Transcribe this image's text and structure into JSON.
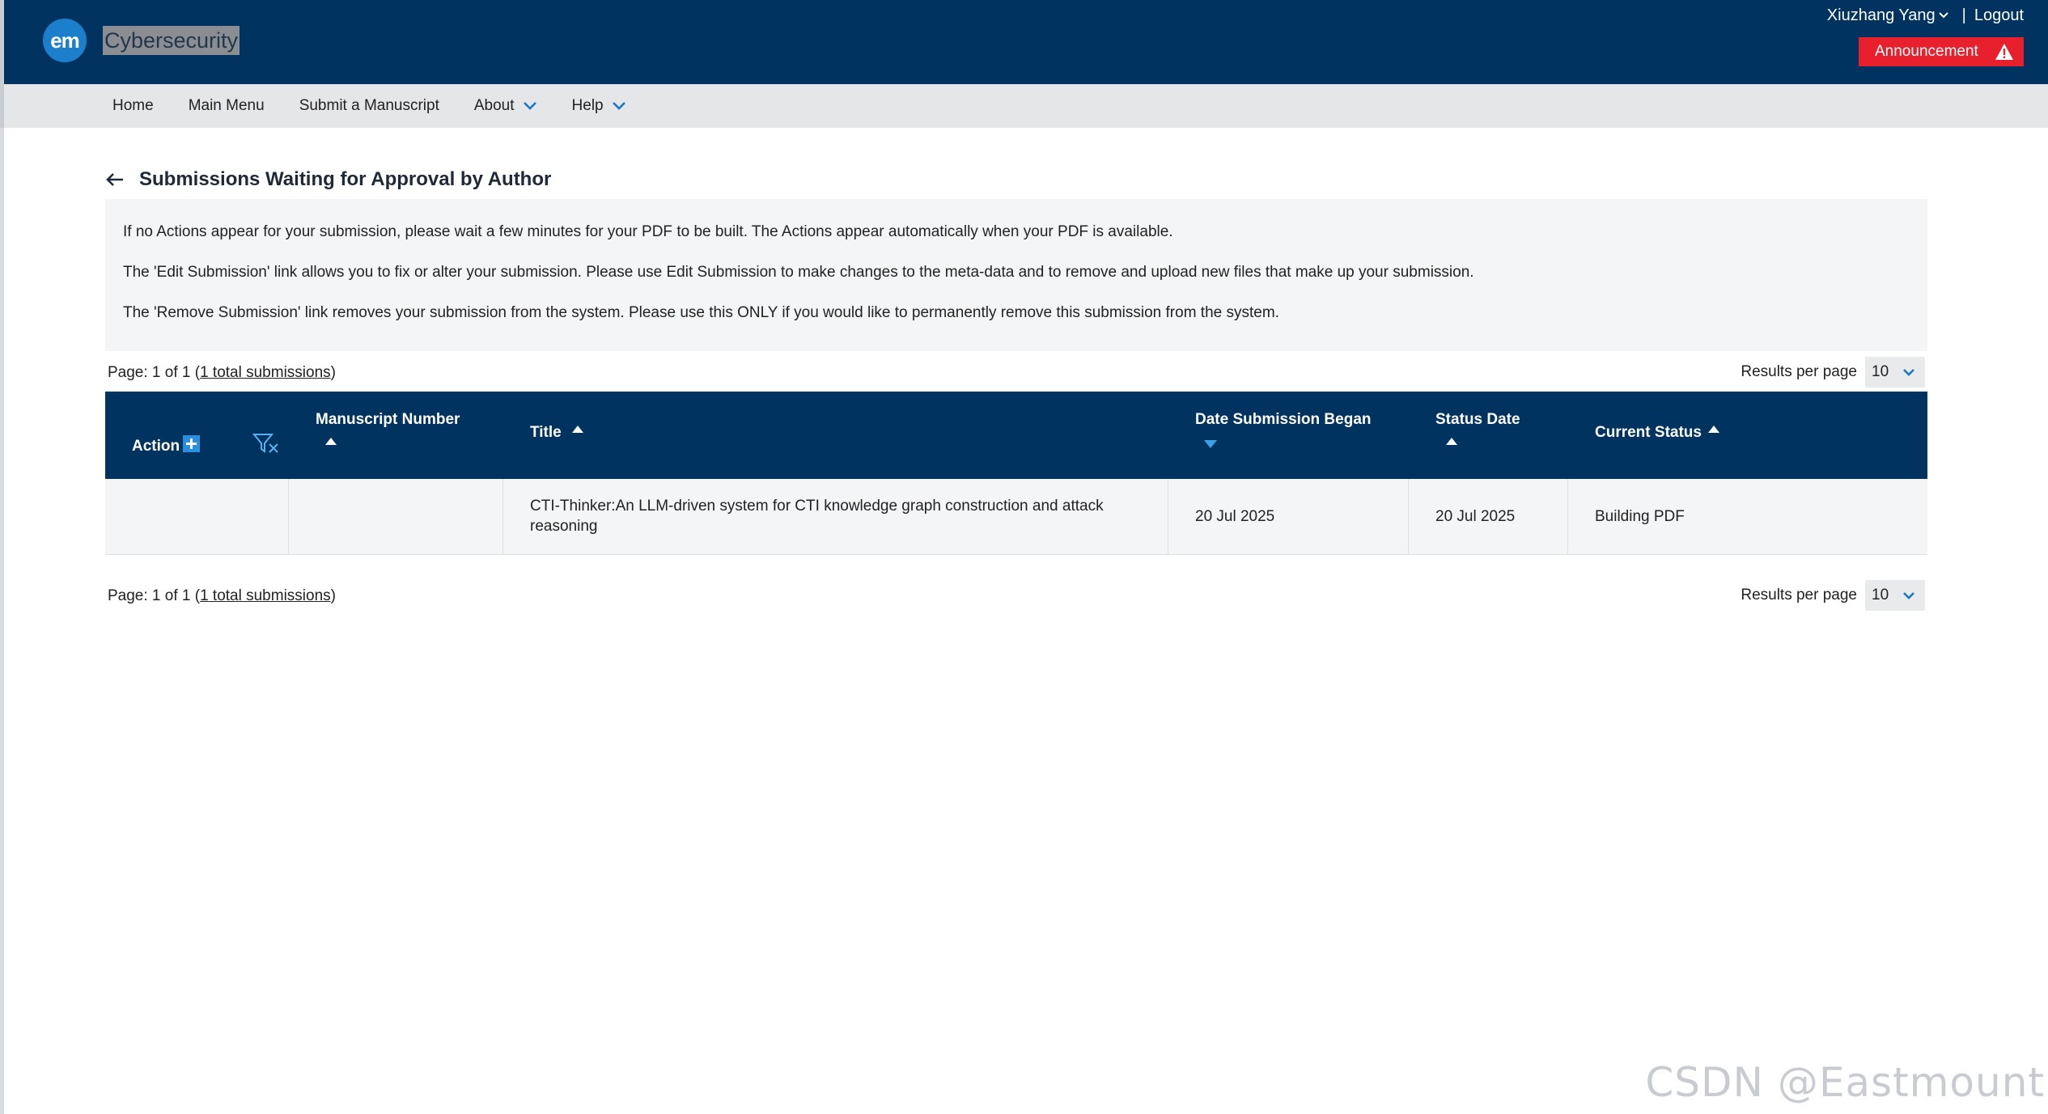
{
  "header": {
    "logo_text": "em",
    "journal_name": "Cybersecurity",
    "user_name": "Xiuzhang Yang",
    "separator": "|",
    "logout_label": "Logout",
    "announcement_label": "Announcement",
    "colors": {
      "header_bg": "#00335f",
      "announcement_bg": "#e8202e",
      "logo_bg": "#1c7fcb"
    }
  },
  "nav": {
    "items": [
      {
        "label": "Home",
        "has_dropdown": false
      },
      {
        "label": "Main Menu",
        "has_dropdown": false
      },
      {
        "label": "Submit a Manuscript",
        "has_dropdown": false
      },
      {
        "label": "About",
        "has_dropdown": true
      },
      {
        "label": "Help",
        "has_dropdown": true
      }
    ]
  },
  "page": {
    "title": "Submissions Waiting for Approval by Author",
    "info": [
      "If no Actions appear for your submission, please wait a few minutes for your PDF to be built. The Actions appear automatically when your PDF is available.",
      "The 'Edit Submission' link allows you to fix or alter your submission. Please use Edit Submission to make changes to the meta-data and to remove and upload new files that make up your submission.",
      "The 'Remove Submission' link removes your submission from the system. Please use this ONLY if you would like to permanently remove this submission from the system."
    ]
  },
  "pager": {
    "page_text": "Page: 1 of 1 (",
    "total_link": "1 total submissions",
    "close_paren": ")",
    "results_per_page_label": "Results per page",
    "results_per_page_value": "10"
  },
  "table": {
    "headers": {
      "action": "Action",
      "manuscript_number": "Manuscript Number",
      "title": "Title",
      "date_began": "Date Submission Began",
      "status_date": "Status Date",
      "current_status": "Current Status"
    },
    "rows": [
      {
        "action": "",
        "manuscript_number": "",
        "title_line1": "CTI-Thinker:An LLM-driven system for CTI knowledge graph construction and attack",
        "title_line2": "reasoning",
        "date_began": "20 Jul 2025",
        "status_date": "20 Jul 2025",
        "current_status": "Building PDF"
      }
    ]
  },
  "watermark": "CSDN @Eastmount"
}
